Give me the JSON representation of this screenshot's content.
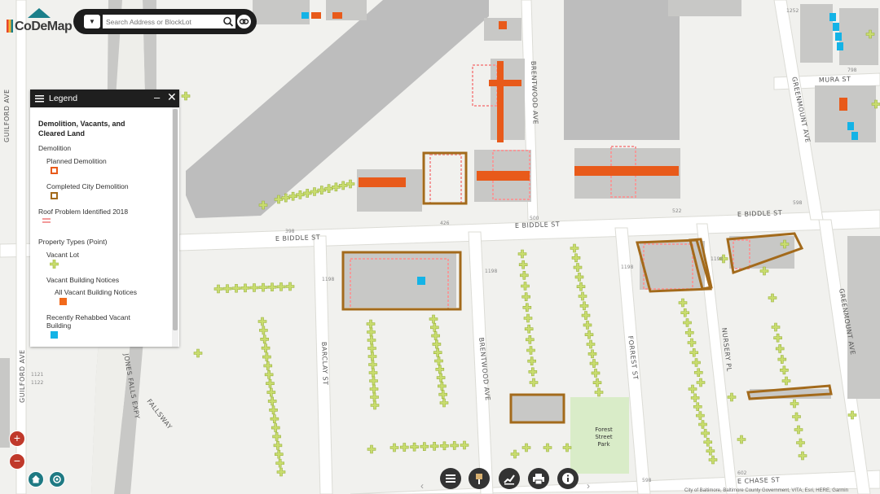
{
  "app": {
    "logo_text": "CoDeMap"
  },
  "search": {
    "placeholder": "Search Address or BlockLot",
    "dropdown_icon": "caret-down-icon",
    "search_icon": "magnifier-icon",
    "link_icon": "link-icon"
  },
  "legend": {
    "title": "Legend",
    "layer_title": "Demolition, Vacants, and Cleared Land",
    "demolition_header": "Demolition",
    "planned_demolition": "Planned Demolition",
    "completed_demolition": "Completed City Demolition",
    "roof_problem": "Roof Problem Identified 2018",
    "property_types": "Property Types (Point)",
    "vacant_lot": "Vacant Lot",
    "vbn_header": "Vacant Building Notices",
    "all_vbn": "All Vacant Building Notices",
    "rehabbed": "Recently Rehabbed Vacant Building",
    "colors": {
      "planned": "#e85a1a",
      "completed": "#a36a1b",
      "roof": "#f39a9a",
      "vacant_lot": "#c8dc6e",
      "vbn": "#f26a1b",
      "rehab": "#14b3e6"
    }
  },
  "streets": {
    "guilford_ave": "GUILFORD AVE",
    "guilford_ave_2": "GUILFORD AVE",
    "jones_falls": "JONES FALLS EXPY",
    "fallsway": "FALLSWAY",
    "barclay": "BARCLAY ST",
    "brentwood": "BRENTWOOD AVE",
    "brentwood_2": "BRENTWOOD AVE",
    "forrest": "FORREST ST",
    "nursery": "NURSERY PL",
    "greenmount": "GREENMOUNT AVE",
    "greenmount_2": "GREENMOUNT AVE",
    "mura": "MURA ST",
    "e_biddle_1": "E BIDDLE ST",
    "e_biddle_2": "E BIDDLE ST",
    "e_biddle_3": "E BIDDLE ST",
    "e_chase": "E CHASE ST"
  },
  "addresses": {
    "a1": "398",
    "a2": "426",
    "a3": "500",
    "a4": "522",
    "a5": "598",
    "a6": "1198",
    "a7": "1198",
    "a8": "1198",
    "a9": "1198",
    "a10": "602",
    "a11": "598",
    "a12": "1252",
    "a13": "798",
    "a14": "1121",
    "a15": "1122"
  },
  "park": {
    "line1": "Forest",
    "line2": "Street",
    "line3": "Park"
  },
  "controls": {
    "zoom_in": "+",
    "zoom_out": "−",
    "home_icon": "home-icon",
    "locate_icon": "locate-icon"
  },
  "toolbar": {
    "prev": "‹",
    "next": "›",
    "buttons": [
      "legend-icon",
      "measure-icon",
      "chart-icon",
      "print-icon",
      "info-icon"
    ]
  },
  "attribution": "City of Baltimore, Baltimore County Government, VITA, Esri, HERE, Garmin"
}
